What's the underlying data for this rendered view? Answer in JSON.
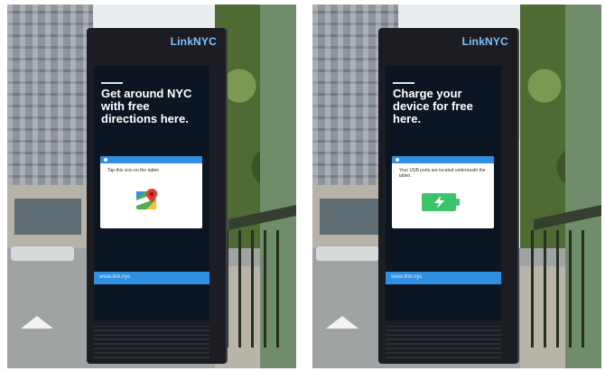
{
  "photos": [
    {
      "brand": "LinkNYC",
      "headline": "Get around NYC with free directions here.",
      "card_text": "Tap this icon on the tablet",
      "icon": "google-maps-icon",
      "url": "www.link.nyc"
    },
    {
      "brand": "LinkNYC",
      "headline": "Charge your device for free here.",
      "card_text": "Your USB ports are located underneath the tablet.",
      "icon": "battery-charging-icon",
      "url": "www.link.nyc"
    }
  ],
  "colors": {
    "accent_blue": "#2f8fe1",
    "screen_bg": "#0b1622",
    "battery_green": "#3cc46a"
  }
}
